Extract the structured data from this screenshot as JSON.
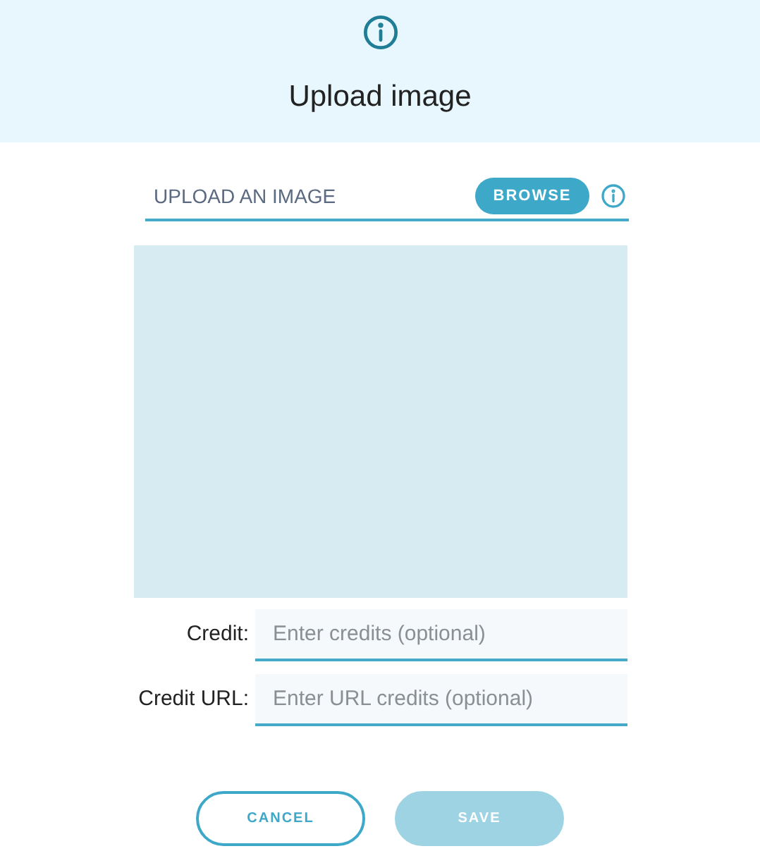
{
  "dialog": {
    "title": "Upload image"
  },
  "upload": {
    "label": "UPLOAD AN IMAGE",
    "browse_button": "BROWSE"
  },
  "preview": {
    "kind": "empty"
  },
  "fields": [
    {
      "label": "Credit:",
      "placeholder": "Enter credits (optional)"
    },
    {
      "label": "Credit URL:",
      "placeholder": "Enter URL credits (optional)"
    }
  ],
  "buttons": [
    {
      "label": "CANCEL",
      "kind": "secondary",
      "disabled": false
    },
    {
      "label": "SAVE",
      "kind": "primary",
      "disabled": true
    }
  ]
}
